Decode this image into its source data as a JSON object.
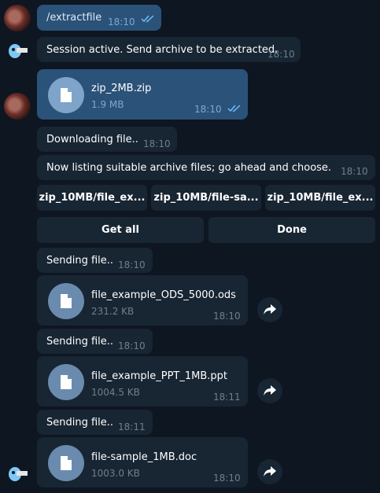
{
  "messages": {
    "cmd": {
      "text": "/extractfile",
      "time": "18:10"
    },
    "session": {
      "text": "Session active. Send archive to be extracted.",
      "time": "18:10"
    },
    "upload": {
      "name": "zip_2MB.zip",
      "size": "1.9 MB",
      "time": "18:10"
    },
    "downloading": {
      "text": "Downloading file..",
      "time": "18:10"
    },
    "listing": {
      "text": "Now listing suitable archive files; go ahead and choose.",
      "time": "18:10"
    },
    "sending1": {
      "text": "Sending file..",
      "time": "18:10"
    },
    "file1": {
      "name": "file_example_ODS_5000.ods",
      "size": "231.2 KB",
      "time": "18:10"
    },
    "sending2": {
      "text": "Sending file..",
      "time": "18:10"
    },
    "file2": {
      "name": "file_example_PPT_1MB.ppt",
      "size": "1004.5 KB",
      "time": "18:11"
    },
    "sending3": {
      "text": "Sending file..",
      "time": "18:11"
    },
    "file3": {
      "name": "file-sample_1MB.doc",
      "size": "1003.0 KB",
      "time": "18:10"
    }
  },
  "keyboard": {
    "row1": [
      "zip_10MB/file_ex...",
      "zip_10MB/file-sa...",
      "zip_10MB/file_ex..."
    ],
    "get_all": "Get all",
    "done": "Done"
  },
  "colors": {
    "background": "#0e1621",
    "incoming": "#182533",
    "outgoing": "#2b5278",
    "accent": "#72bcfd"
  }
}
